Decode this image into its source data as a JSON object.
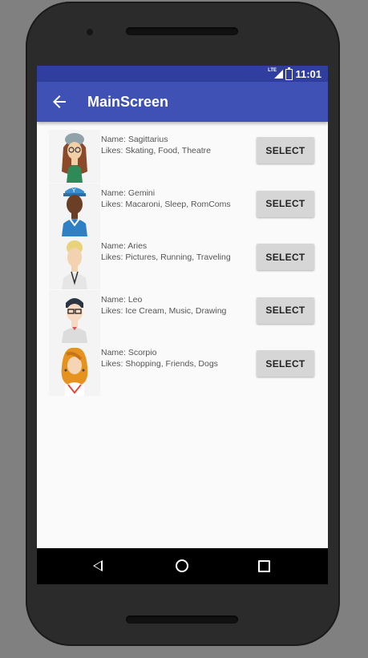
{
  "status_bar": {
    "time": "11:01",
    "network": "LTE"
  },
  "app_bar": {
    "title": "MainScreen",
    "back_icon": "arrow-back-icon"
  },
  "characters": [
    {
      "name": "Name: Sagittarius",
      "likes": "Likes: Skating, Food, Theatre",
      "button": "SELECT"
    },
    {
      "name": "Name: Gemini",
      "likes": "Likes: Macaroni, Sleep, RomComs",
      "button": "SELECT"
    },
    {
      "name": "Name: Aries",
      "likes": "Likes: Pictures, Running, Traveling",
      "button": "SELECT"
    },
    {
      "name": "Name: Leo",
      "likes": "Likes: Ice Cream, Music, Drawing",
      "button": "SELECT"
    },
    {
      "name": "Name: Scorpio",
      "likes": "Likes: Shopping, Friends, Dogs",
      "button": "SELECT"
    }
  ],
  "nav_bar": {
    "back_icon": "nav-back-icon",
    "home_icon": "nav-home-icon",
    "recents_icon": "nav-recents-icon"
  },
  "colors": {
    "status_bar": "#303f9f",
    "app_bar": "#3f51b5",
    "button": "#d6d6d6"
  }
}
